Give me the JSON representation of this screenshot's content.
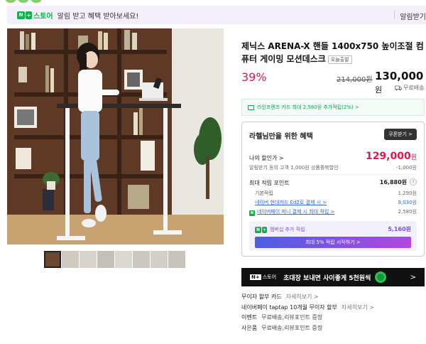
{
  "banner": {
    "logo_n": "N",
    "logo_plus": "+",
    "logo_store": "스토어",
    "message": "알림 받고 혜택 받아보세요!",
    "right_text": "알림받기"
  },
  "product": {
    "title": "제닉스 ARENA-X 핸들 1400x750 높이조절 컴퓨터 게이밍 모션데스크",
    "badge": "오늘출발",
    "discount": "39%",
    "original_price": "214,000원",
    "price_value": "130,000",
    "price_unit": "원",
    "shipping": "무료배송"
  },
  "card_promo": "라인프렌즈 카드 최대 2,580원 추가적립(2%) >",
  "benefit": {
    "heading": "라헬님만을 위한 혜택",
    "coupon_button": "쿠폰받기 >",
    "my_discount_label": "나의 할인가 >",
    "my_discount_value": "129,000",
    "my_discount_unit": "원",
    "alert_coupon_label": "알림받기 동의 고객 1,000원 상품중복할인",
    "alert_coupon_value": "-1,000원",
    "points_label": "최대 적립 포인트",
    "points_value": "16,880원",
    "qmark": "?",
    "basic_label": "기본적립",
    "basic_value": "1,290원",
    "hyundai_label": "네이버 현대카드 Ed2로 결제 시 >",
    "hyundai_value": "9,030원",
    "money_label": "네이버페이 머니 결제 시 최대 적립 >",
    "money_value": "2,580원",
    "membership_label": "멤버십 추가 적립",
    "membership_value": "5,160원",
    "membership_button": "최대 5% 적립 시작하기 >"
  },
  "nstore_banner": {
    "logo_b": "N+",
    "logo_text": "스토어",
    "text": "초대장 보내면 사이좋게 5천원씩",
    "arrow": ">"
  },
  "info_rows": [
    {
      "label": "무이자 할부 카드",
      "sub": "자세히보기 >"
    },
    {
      "label": "네이버페이 taptap 10개월 무이자 할부",
      "sub": "자세히보기 >"
    },
    {
      "label": "이벤트",
      "sub": "무료배송,리뷰포인트 증정"
    },
    {
      "label": "사은품",
      "sub": "무료배송,리뷰포인트 증정"
    }
  ],
  "icons": {
    "truck": "truck-icon",
    "card": "card-icon",
    "coin": "coin-icon"
  },
  "colors": {
    "accent_red": "#e0174c",
    "naver_green": "#12b04a",
    "membership_purple": "#7b4de0"
  }
}
